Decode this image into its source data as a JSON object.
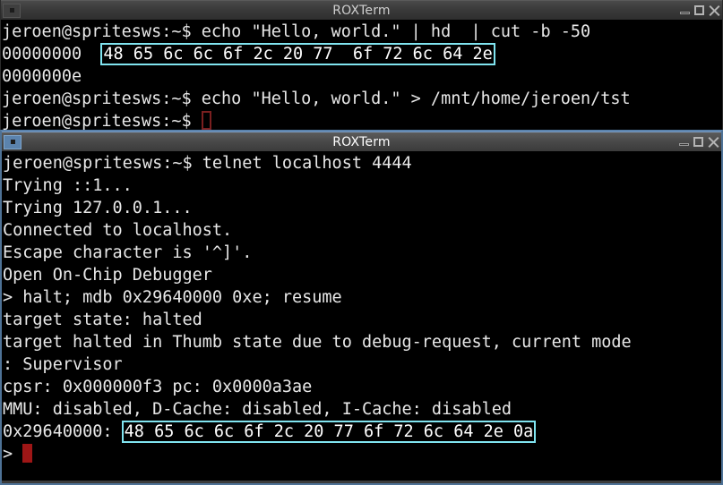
{
  "windows": [
    {
      "id": "terminal-top",
      "title": "ROXTerm",
      "focused": false,
      "controls": {
        "menu_label": "window-menu",
        "minimize_label": "Minimize",
        "maximize_label": "Maximize",
        "close_label": "Close"
      },
      "lines": [
        {
          "pre": "jeroen@spritesws:~$ echo \"Hello, world.\" | hd  | cut -b -50"
        },
        {
          "pre": "00000000  ",
          "highlight": "48 65 6c 6c 6f 2c 20 77  6f 72 6c 64 2e"
        },
        {
          "pre": "0000000e"
        },
        {
          "pre": "jeroen@spritesws:~$ echo \"Hello, world.\" > /mnt/home/jeroen/tst"
        },
        {
          "pre": "jeroen@spritesws:~$ ",
          "cursor": "hollow"
        }
      ]
    },
    {
      "id": "terminal-bottom",
      "title": "ROXTerm",
      "focused": true,
      "controls": {
        "menu_label": "window-menu",
        "minimize_label": "Minimize",
        "maximize_label": "Maximize",
        "close_label": "Close"
      },
      "lines": [
        {
          "pre": "jeroen@spritesws:~$ telnet localhost 4444"
        },
        {
          "pre": "Trying ::1..."
        },
        {
          "pre": "Trying 127.0.0.1..."
        },
        {
          "pre": "Connected to localhost."
        },
        {
          "pre": "Escape character is '^]'."
        },
        {
          "pre": "Open On-Chip Debugger"
        },
        {
          "pre": "> halt; mdb 0x29640000 0xe; resume"
        },
        {
          "pre": "target state: halted"
        },
        {
          "pre": "target halted in Thumb state due to debug-request, current mode"
        },
        {
          "pre": ": Supervisor"
        },
        {
          "pre": "cpsr: 0x000000f3 pc: 0x0000a3ae"
        },
        {
          "pre": "MMU: disabled, D-Cache: disabled, I-Cache: disabled"
        },
        {
          "pre": "0x29640000: ",
          "highlight": "48 65 6c 6c 6f 2c 20 77 6f 72 6c 64 2e 0a"
        },
        {
          "pre": "> ",
          "cursor": "block"
        }
      ]
    }
  ],
  "colors": {
    "terminal_background": "#000000",
    "terminal_foreground": "#e8e8e8",
    "selection_border": "#80e4f0",
    "cursor_focused": "#9e1616",
    "cursor_unfocused": "#7a1f1f",
    "titlebar_focused": "#5b83ad",
    "titlebar_unfocused": "#3a3a3a"
  }
}
